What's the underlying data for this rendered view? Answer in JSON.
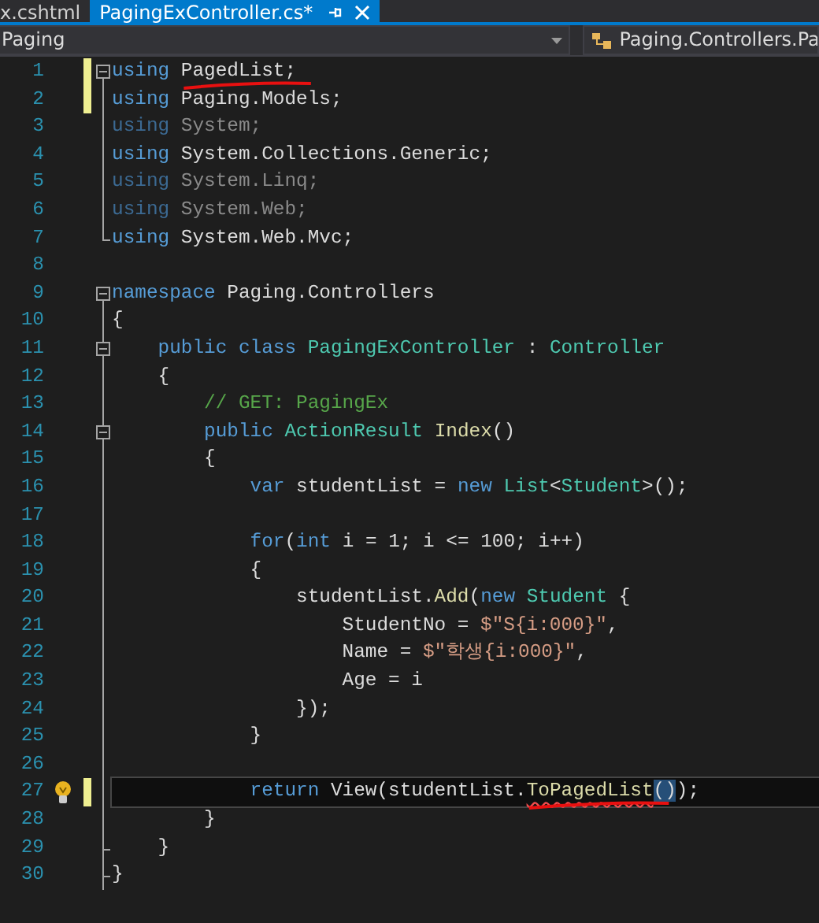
{
  "tabs": [
    {
      "label": "x.cshtml",
      "selected": false
    },
    {
      "label": "PagingExController.cs*",
      "selected": true
    }
  ],
  "navigation_bar": {
    "project": "Paging",
    "member": "Paging.Controllers.Pa"
  },
  "lines": [
    {
      "number": "1",
      "collapsible": true,
      "region_end": false,
      "modified": true,
      "dimmed": false,
      "current": false,
      "lightbulb": false,
      "tokens": [
        {
          "text": "using ",
          "kind": "kw"
        },
        {
          "text": "PagedList;",
          "kind": "plain",
          "marked": true
        }
      ]
    },
    {
      "number": "2",
      "collapsible": false,
      "region_end": false,
      "modified": true,
      "dimmed": false,
      "current": false,
      "lightbulb": false,
      "tokens": [
        {
          "text": "using ",
          "kind": "kw"
        },
        {
          "text": "Paging.Models;",
          "kind": "plain"
        }
      ]
    },
    {
      "number": "3",
      "collapsible": false,
      "region_end": false,
      "modified": false,
      "dimmed": true,
      "current": false,
      "lightbulb": false,
      "tokens": [
        {
          "text": "using ",
          "kind": "kw"
        },
        {
          "text": "System;",
          "kind": "plain"
        }
      ]
    },
    {
      "number": "4",
      "collapsible": false,
      "region_end": false,
      "modified": false,
      "dimmed": false,
      "current": false,
      "lightbulb": false,
      "tokens": [
        {
          "text": "using ",
          "kind": "kw"
        },
        {
          "text": "System.Collections.Generic;",
          "kind": "plain"
        }
      ]
    },
    {
      "number": "5",
      "collapsible": false,
      "region_end": false,
      "modified": false,
      "dimmed": true,
      "current": false,
      "lightbulb": false,
      "tokens": [
        {
          "text": "using ",
          "kind": "kw"
        },
        {
          "text": "System.Linq;",
          "kind": "plain"
        }
      ]
    },
    {
      "number": "6",
      "collapsible": false,
      "region_end": false,
      "modified": false,
      "dimmed": true,
      "current": false,
      "lightbulb": false,
      "tokens": [
        {
          "text": "using ",
          "kind": "kw"
        },
        {
          "text": "System.Web;",
          "kind": "plain"
        }
      ]
    },
    {
      "number": "7",
      "collapsible": false,
      "region_end": true,
      "modified": false,
      "dimmed": false,
      "current": false,
      "lightbulb": false,
      "tokens": [
        {
          "text": "using ",
          "kind": "kw"
        },
        {
          "text": "System.Web.Mvc;",
          "kind": "plain"
        }
      ]
    },
    {
      "number": "8",
      "collapsible": false,
      "region_end": false,
      "modified": false,
      "current": false,
      "lightbulb": false
    },
    {
      "number": "9",
      "collapsible": true,
      "region_end": false,
      "modified": false,
      "dimmed": false,
      "current": false,
      "lightbulb": false,
      "tokens": [
        {
          "text": "namespace ",
          "kind": "kw"
        },
        {
          "text": "Paging.Controllers",
          "kind": "plain"
        }
      ]
    },
    {
      "number": "10",
      "collapsible": false,
      "region_end": false,
      "modified": false,
      "dimmed": false,
      "current": false,
      "lightbulb": false,
      "tokens": [
        {
          "text": "{",
          "kind": "plain"
        }
      ]
    },
    {
      "number": "11",
      "collapsible": true,
      "region_end": false,
      "modified": false,
      "dimmed": false,
      "current": false,
      "lightbulb": false,
      "tokens": [
        {
          "text": "    public class ",
          "kind": "kw"
        },
        {
          "text": "PagingExController",
          "kind": "type"
        },
        {
          "text": " : ",
          "kind": "plain"
        },
        {
          "text": "Controller",
          "kind": "type"
        }
      ]
    },
    {
      "number": "12",
      "collapsible": false,
      "region_end": false,
      "modified": false,
      "dimmed": false,
      "current": false,
      "lightbulb": false,
      "tokens": [
        {
          "text": "    {",
          "kind": "plain"
        }
      ]
    },
    {
      "number": "13",
      "collapsible": false,
      "region_end": false,
      "modified": false,
      "dimmed": false,
      "current": false,
      "lightbulb": false,
      "tokens": [
        {
          "text": "        // GET: PagingEx",
          "kind": "comment"
        }
      ]
    },
    {
      "number": "14",
      "collapsible": true,
      "region_end": false,
      "modified": false,
      "dimmed": false,
      "current": false,
      "lightbulb": false,
      "tokens": [
        {
          "text": "        public ",
          "kind": "kw"
        },
        {
          "text": "ActionResult",
          "kind": "type"
        },
        {
          "text": " Index",
          "kind": "method"
        },
        {
          "text": "()",
          "kind": "plain"
        }
      ]
    },
    {
      "number": "15",
      "collapsible": false,
      "region_end": false,
      "modified": false,
      "dimmed": false,
      "current": false,
      "lightbulb": false,
      "tokens": [
        {
          "text": "        {",
          "kind": "plain"
        }
      ]
    },
    {
      "number": "16",
      "collapsible": false,
      "region_end": false,
      "modified": false,
      "dimmed": false,
      "current": false,
      "lightbulb": false,
      "tokens": [
        {
          "text": "            var ",
          "kind": "kw"
        },
        {
          "text": "studentList = ",
          "kind": "plain"
        },
        {
          "text": "new ",
          "kind": "kw"
        },
        {
          "text": "List",
          "kind": "type"
        },
        {
          "text": "<",
          "kind": "plain"
        },
        {
          "text": "Student",
          "kind": "type"
        },
        {
          "text": ">();",
          "kind": "plain"
        }
      ]
    },
    {
      "number": "17",
      "collapsible": false,
      "region_end": false,
      "modified": false,
      "current": false,
      "lightbulb": false
    },
    {
      "number": "18",
      "collapsible": false,
      "region_end": false,
      "modified": false,
      "dimmed": false,
      "current": false,
      "lightbulb": false,
      "tokens": [
        {
          "text": "            for",
          "kind": "kw"
        },
        {
          "text": "(",
          "kind": "plain"
        },
        {
          "text": "int ",
          "kind": "kw"
        },
        {
          "text": "i = 1; i <= 100; i++)",
          "kind": "plain"
        }
      ]
    },
    {
      "number": "19",
      "collapsible": false,
      "region_end": false,
      "modified": false,
      "dimmed": false,
      "current": false,
      "lightbulb": false,
      "tokens": [
        {
          "text": "            {",
          "kind": "plain"
        }
      ]
    },
    {
      "number": "20",
      "collapsible": false,
      "region_end": false,
      "modified": false,
      "dimmed": false,
      "current": false,
      "lightbulb": false,
      "tokens": [
        {
          "text": "                studentList.",
          "kind": "plain"
        },
        {
          "text": "Add",
          "kind": "method"
        },
        {
          "text": "(",
          "kind": "plain"
        },
        {
          "text": "new ",
          "kind": "kw"
        },
        {
          "text": "Student",
          "kind": "type"
        },
        {
          "text": " {",
          "kind": "plain"
        }
      ]
    },
    {
      "number": "21",
      "collapsible": false,
      "region_end": false,
      "modified": false,
      "dimmed": false,
      "current": false,
      "lightbulb": false,
      "tokens": [
        {
          "text": "                    StudentNo = ",
          "kind": "plain"
        },
        {
          "text": "$\"S{i:000}\"",
          "kind": "string"
        },
        {
          "text": ",",
          "kind": "plain"
        }
      ]
    },
    {
      "number": "22",
      "collapsible": false,
      "region_end": false,
      "modified": false,
      "dimmed": false,
      "current": false,
      "lightbulb": false,
      "tokens": [
        {
          "text": "                    Name = ",
          "kind": "plain"
        },
        {
          "text": "$\"학생{i:000}\"",
          "kind": "string"
        },
        {
          "text": ",",
          "kind": "plain"
        }
      ]
    },
    {
      "number": "23",
      "collapsible": false,
      "region_end": false,
      "modified": false,
      "dimmed": false,
      "current": false,
      "lightbulb": false,
      "tokens": [
        {
          "text": "                    Age = i",
          "kind": "plain"
        }
      ]
    },
    {
      "number": "24",
      "collapsible": false,
      "region_end": false,
      "modified": false,
      "dimmed": false,
      "current": false,
      "lightbulb": false,
      "tokens": [
        {
          "text": "                });",
          "kind": "plain"
        }
      ]
    },
    {
      "number": "25",
      "collapsible": false,
      "region_end": false,
      "modified": false,
      "dimmed": false,
      "current": false,
      "lightbulb": false,
      "tokens": [
        {
          "text": "            }",
          "kind": "plain"
        }
      ]
    },
    {
      "number": "26",
      "collapsible": false,
      "region_end": false,
      "modified": false,
      "current": false,
      "lightbulb": false
    },
    {
      "number": "27",
      "collapsible": false,
      "region_end": false,
      "modified": true,
      "dimmed": false,
      "current": true,
      "lightbulb": true,
      "tokens": [
        {
          "text": "            return ",
          "kind": "kw"
        },
        {
          "text": "View(studentList.",
          "kind": "plain"
        },
        {
          "text": "ToPagedList",
          "kind": "method",
          "error": true,
          "marked": true
        },
        {
          "text": "()",
          "kind": "plain",
          "highlight": true
        },
        {
          "text": ");",
          "kind": "plain"
        }
      ]
    },
    {
      "number": "28",
      "collapsible": false,
      "region_end": false,
      "modified": false,
      "dimmed": false,
      "current": false,
      "lightbulb": false,
      "tokens": [
        {
          "text": "        }",
          "kind": "plain"
        }
      ]
    },
    {
      "number": "29",
      "collapsible": false,
      "region_end": true,
      "modified": false,
      "dimmed": false,
      "current": false,
      "lightbulb": false,
      "tokens": [
        {
          "text": "    }",
          "kind": "plain"
        }
      ]
    },
    {
      "number": "30",
      "collapsible": false,
      "region_end": true,
      "modified": false,
      "dimmed": false,
      "current": false,
      "lightbulb": false,
      "tokens": [
        {
          "text": "}",
          "kind": "plain"
        }
      ]
    }
  ]
}
